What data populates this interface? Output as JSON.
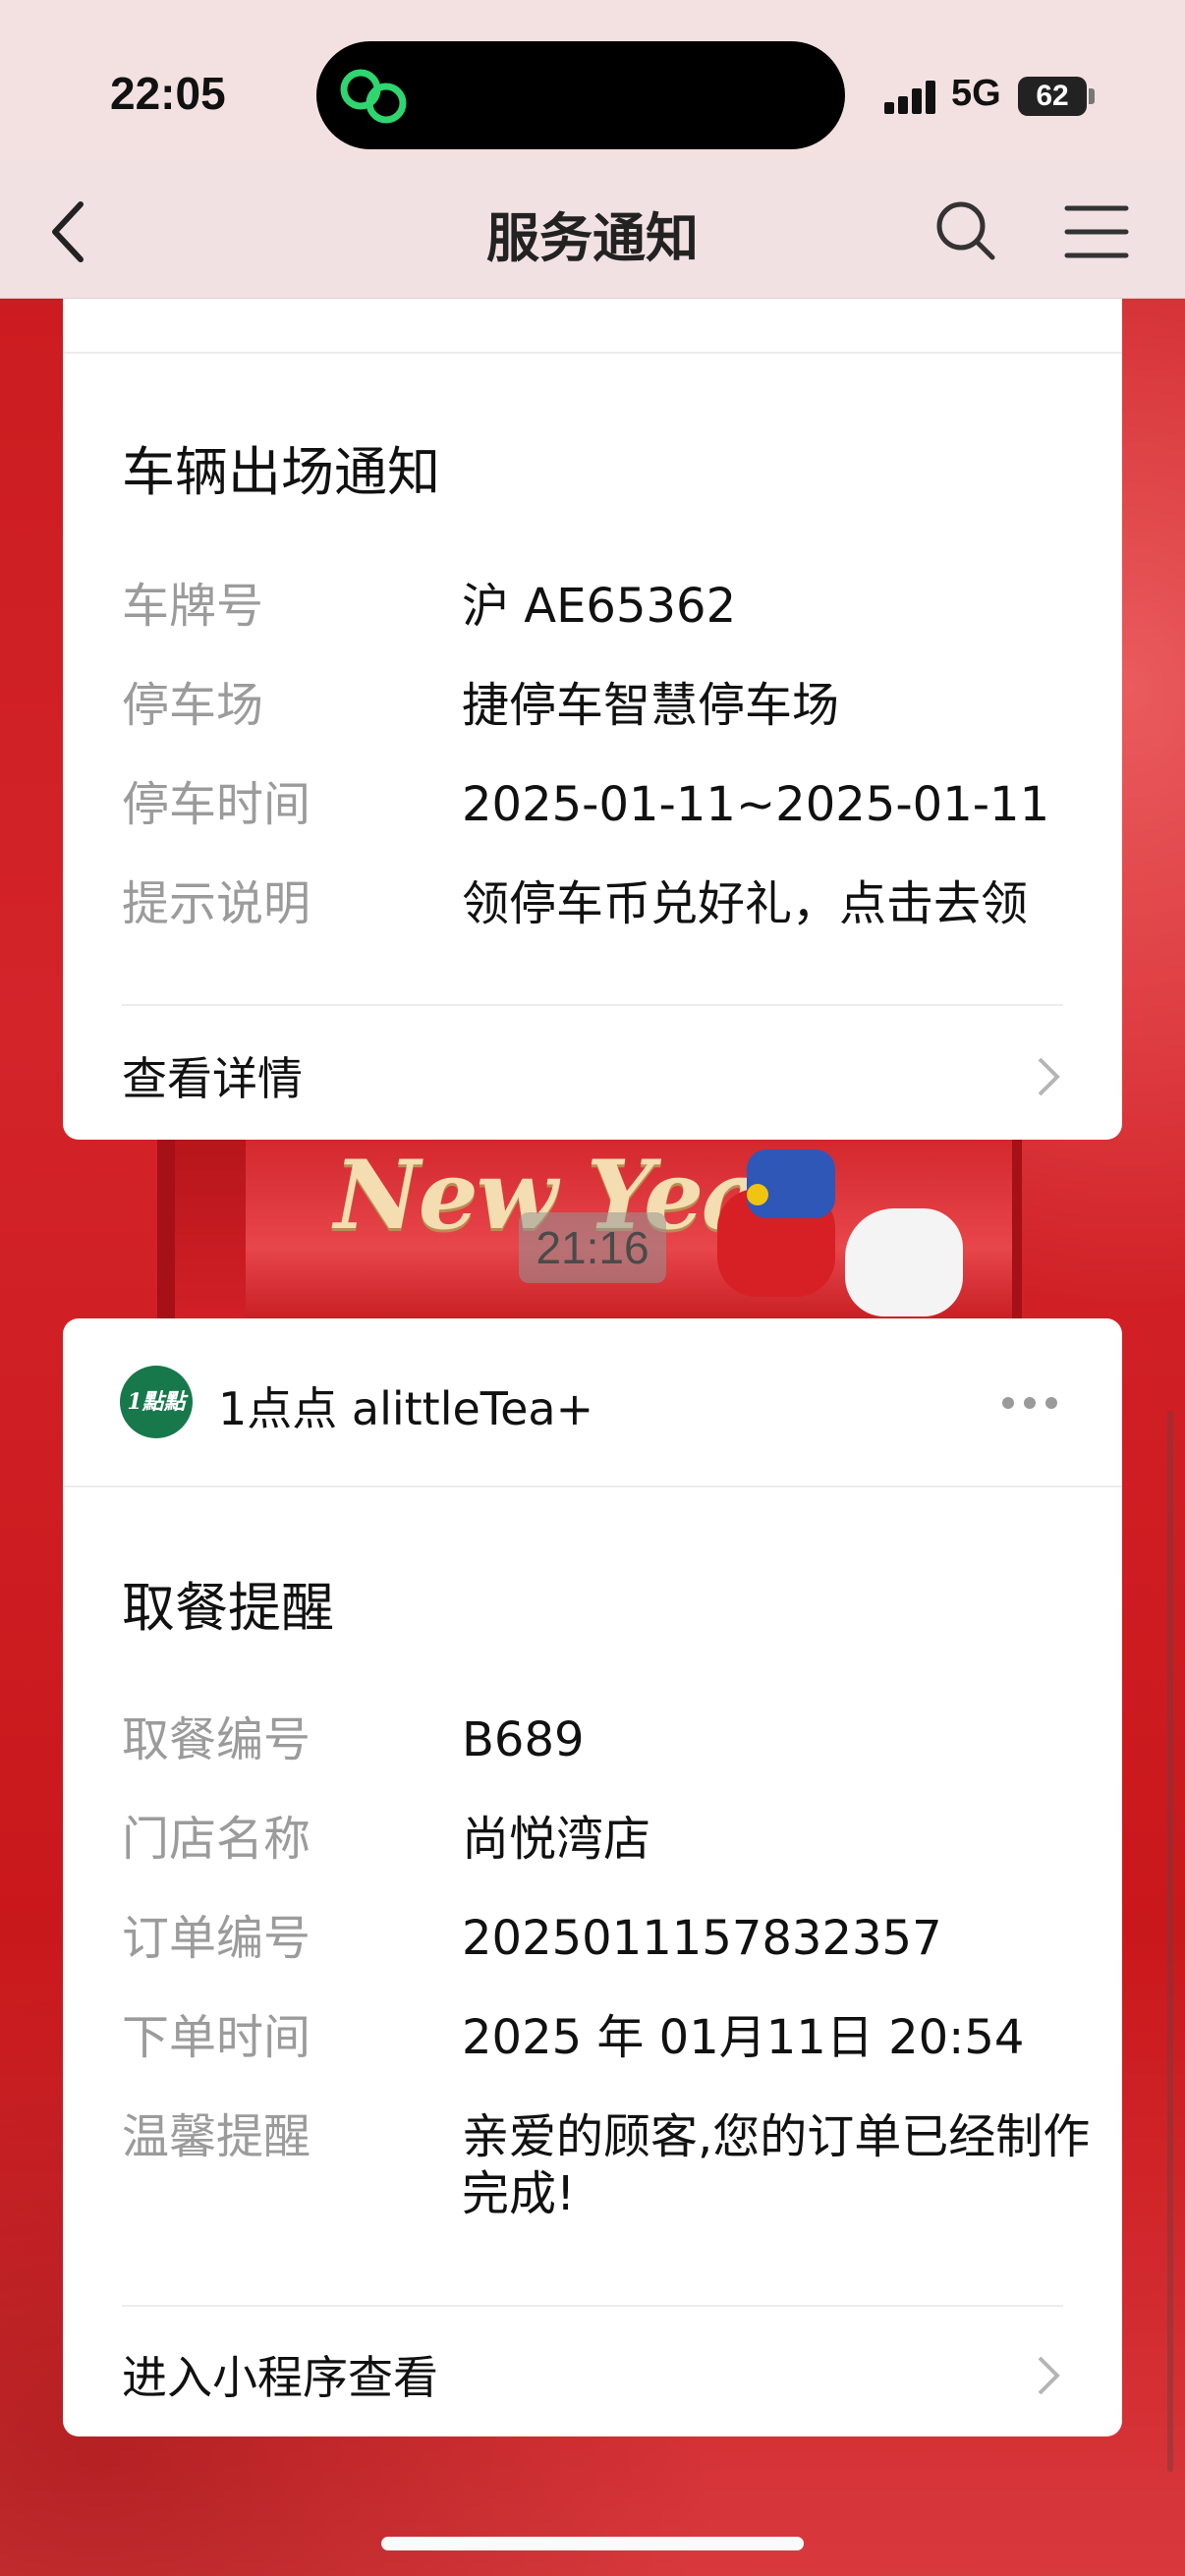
{
  "status_bar": {
    "time": "22:05",
    "network": "5G",
    "battery": "62"
  },
  "nav": {
    "title": "服务通知"
  },
  "background": {
    "banner_text": "New Year",
    "timestamp": "21:16"
  },
  "card1": {
    "title": "车辆出场通知",
    "fields": [
      {
        "label": "车牌号",
        "value": "沪 AE65362"
      },
      {
        "label": "停车场",
        "value": "捷停车智慧停车场"
      },
      {
        "label": "停车时间",
        "value": "2025-01-11~2025-01-11"
      },
      {
        "label": "提示说明",
        "value": "领停车币兑好礼，点击去领"
      }
    ],
    "footer": "查看详情"
  },
  "card2": {
    "sender": "1点点 alittleTea+",
    "avatar_text": "1點點",
    "title": "取餐提醒",
    "fields": [
      {
        "label": "取餐编号",
        "value": "B689"
      },
      {
        "label": "门店名称",
        "value": "尚悦湾店"
      },
      {
        "label": "订单编号",
        "value": "2025011157832357"
      },
      {
        "label": "下单时间",
        "value": "2025 年 01月11日 20:54"
      },
      {
        "label": "温馨提醒",
        "value": "亲爱的顾客,您的订单已经制作完成!"
      }
    ],
    "footer": "进入小程序查看"
  },
  "colors": {
    "background_red": "#c8191d",
    "avatar_green": "#17784b",
    "label_gray": "#9b9b9b"
  }
}
